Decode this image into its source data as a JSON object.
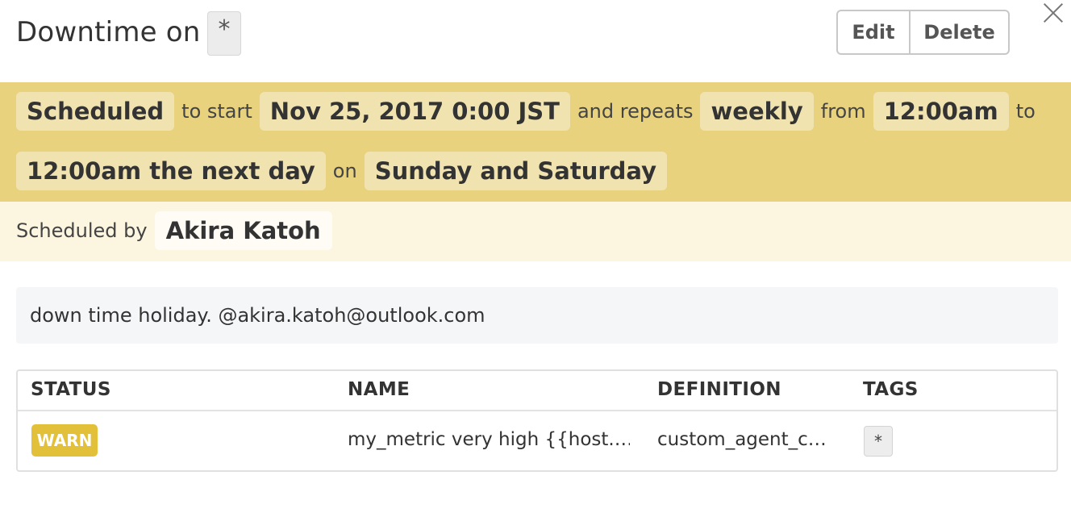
{
  "header": {
    "title": "Downtime on",
    "scope": "*",
    "edit_label": "Edit",
    "delete_label": "Delete"
  },
  "schedule": {
    "status": "Scheduled",
    "to_start_text": "to start",
    "start_time": "Nov 25, 2017 0:00 JST",
    "repeats_text": "and repeats",
    "frequency": "weekly",
    "from_text": "from",
    "from_time": "12:00am",
    "to_text": "to",
    "to_time": "12:00am the next day",
    "on_text": "on",
    "days": "Sunday and Saturday"
  },
  "byline": {
    "label": "Scheduled by",
    "user": "Akira Katoh"
  },
  "message": "down time holiday. @akira.katoh@outlook.com",
  "table": {
    "headers": [
      "STATUS",
      "NAME",
      "DEFINITION",
      "TAGS"
    ],
    "rows": [
      {
        "status": "WARN",
        "name": "my_metric very high {{host.…",
        "definition": "custom_agent_c…",
        "tag": "*"
      }
    ]
  },
  "colors": {
    "schedule_bg": "#e8d27e",
    "byline_bg": "#fcf5df",
    "warn": "#e2c03a"
  },
  "icons": {
    "close": "close-icon"
  }
}
